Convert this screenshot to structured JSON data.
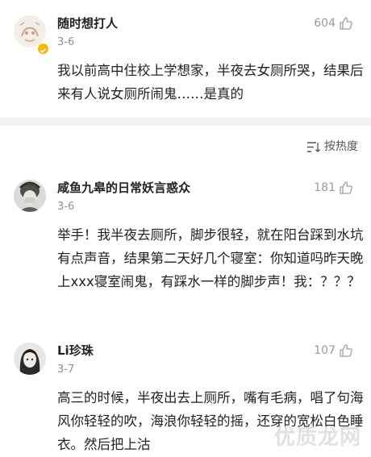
{
  "comments": [
    {
      "username": "随时想打人",
      "date": "3-6",
      "likes": "604",
      "avatar_icon": "cartoon-avatar",
      "verified_icon": "verified-badge-icon",
      "content": "我以前高中住校上学想家，半夜去女厕所哭，结果后来有人说女厕所闹鬼……是真的"
    },
    {
      "username": "咸鱼九皋的日常妖言惑众",
      "date": "3-6",
      "likes": "181",
      "avatar_icon": "masked-figure-avatar",
      "content": "举手！我半夜去厕所，脚步很轻，就在阳台踩到水坑有点声音，结果第二天好几个寝室：你知道吗昨天晚上xxx寝室闹鬼，有踩水一样的脚步声！我：？？？"
    },
    {
      "username": "Li珍珠",
      "date": "3-7",
      "likes": "107",
      "avatar_icon": "dark-hair-avatar",
      "content": "高三的时候，半夜出去上厕所，嘴有毛病，唱了句海风你轻轻的吹，海浪你轻轻的摇，还穿的宽松白色睡衣。然后把上沽"
    }
  ],
  "sort": {
    "label": "按热度",
    "icon": "sort-lines-icon"
  },
  "watermark": "优质龙网",
  "colors": {
    "meta_gray": "#8f8f8f",
    "divider": "#f2f2f2",
    "text": "#1f1f1f"
  }
}
